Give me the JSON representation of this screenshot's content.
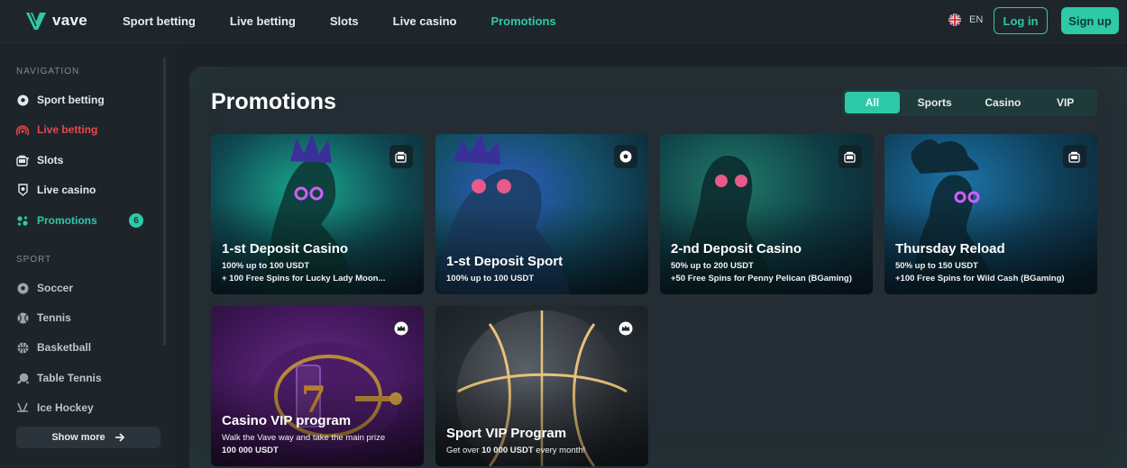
{
  "brand": {
    "name": "vave"
  },
  "topnav": [
    "Sport betting",
    "Live betting",
    "Slots",
    "Live casino",
    "Promotions"
  ],
  "language": "EN",
  "auth": {
    "login": "Log in",
    "signup": "Sign up"
  },
  "sidebar": {
    "navigation_heading": "NAVIGATION",
    "nav_items": [
      {
        "label": "Sport betting",
        "icon": "soccer-ball-icon"
      },
      {
        "label": "Live betting",
        "icon": "live-broadcast-icon"
      },
      {
        "label": "Slots",
        "icon": "slot-machine-icon"
      },
      {
        "label": "Live casino",
        "icon": "chip-icon"
      },
      {
        "label": "Promotions",
        "icon": "promotions-icon",
        "badge": "6"
      }
    ],
    "sport_heading": "SPORT",
    "sport_items": [
      {
        "label": "Soccer",
        "icon": "soccer-ball-icon"
      },
      {
        "label": "Tennis",
        "icon": "tennis-ball-icon"
      },
      {
        "label": "Basketball",
        "icon": "basketball-icon"
      },
      {
        "label": "Table Tennis",
        "icon": "table-tennis-icon"
      },
      {
        "label": "Ice Hockey",
        "icon": "hockey-stick-icon"
      }
    ],
    "show_more": "Show more"
  },
  "page": {
    "title": "Promotions",
    "filters": [
      "All",
      "Sports",
      "Casino",
      "VIP"
    ],
    "active_filter": "All"
  },
  "promos": [
    {
      "title": "1-st Deposit Casino",
      "line1": "100% up to 100 USDT",
      "line2": "+ 100 Free Spins for Lucky Lady Moon...",
      "icon": "slot-icon"
    },
    {
      "title": "1-st Deposit Sport",
      "line1": "100% up to 100 USDT",
      "line2": "",
      "icon": "soccer-ball-icon"
    },
    {
      "title": "2-nd Deposit Casino",
      "line1": "50% up to 200 USDT",
      "line2": "+50 Free Spins for Penny Pelican (BGaming)",
      "icon": "slot-icon"
    },
    {
      "title": "Thursday Reload",
      "line1": "50% up to 150 USDT",
      "line2": "+100 Free Spins for Wild Cash (BGaming)",
      "icon": "slot-icon"
    },
    {
      "title": "Casino VIP program",
      "line1": "Walk the Vave way and take the main prize",
      "line2": "100 000 USDT",
      "icon": "crown-icon"
    },
    {
      "title": "Sport VIP Program",
      "line1_a": "Get over ",
      "line1_b": "10 000 USDT",
      "line1_c": " every month!",
      "icon": "crown-icon"
    }
  ],
  "colors": {
    "accent": "#2ec9a7",
    "live": "#e5484d",
    "background": "#1b2228"
  }
}
